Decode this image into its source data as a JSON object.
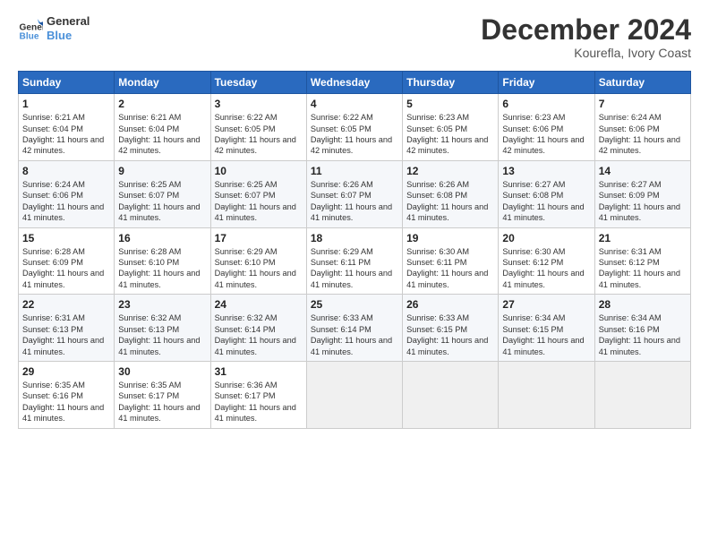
{
  "header": {
    "logo": {
      "line1": "General",
      "line2": "Blue"
    },
    "title": "December 2024",
    "subtitle": "Kourefla, Ivory Coast"
  },
  "days_of_week": [
    "Sunday",
    "Monday",
    "Tuesday",
    "Wednesday",
    "Thursday",
    "Friday",
    "Saturday"
  ],
  "weeks": [
    [
      {
        "day": 1,
        "sunrise": "6:21 AM",
        "sunset": "6:04 PM",
        "daylight": "11 hours and 42 minutes."
      },
      {
        "day": 2,
        "sunrise": "6:21 AM",
        "sunset": "6:04 PM",
        "daylight": "11 hours and 42 minutes."
      },
      {
        "day": 3,
        "sunrise": "6:22 AM",
        "sunset": "6:05 PM",
        "daylight": "11 hours and 42 minutes."
      },
      {
        "day": 4,
        "sunrise": "6:22 AM",
        "sunset": "6:05 PM",
        "daylight": "11 hours and 42 minutes."
      },
      {
        "day": 5,
        "sunrise": "6:23 AM",
        "sunset": "6:05 PM",
        "daylight": "11 hours and 42 minutes."
      },
      {
        "day": 6,
        "sunrise": "6:23 AM",
        "sunset": "6:06 PM",
        "daylight": "11 hours and 42 minutes."
      },
      {
        "day": 7,
        "sunrise": "6:24 AM",
        "sunset": "6:06 PM",
        "daylight": "11 hours and 42 minutes."
      }
    ],
    [
      {
        "day": 8,
        "sunrise": "6:24 AM",
        "sunset": "6:06 PM",
        "daylight": "11 hours and 41 minutes."
      },
      {
        "day": 9,
        "sunrise": "6:25 AM",
        "sunset": "6:07 PM",
        "daylight": "11 hours and 41 minutes."
      },
      {
        "day": 10,
        "sunrise": "6:25 AM",
        "sunset": "6:07 PM",
        "daylight": "11 hours and 41 minutes."
      },
      {
        "day": 11,
        "sunrise": "6:26 AM",
        "sunset": "6:07 PM",
        "daylight": "11 hours and 41 minutes."
      },
      {
        "day": 12,
        "sunrise": "6:26 AM",
        "sunset": "6:08 PM",
        "daylight": "11 hours and 41 minutes."
      },
      {
        "day": 13,
        "sunrise": "6:27 AM",
        "sunset": "6:08 PM",
        "daylight": "11 hours and 41 minutes."
      },
      {
        "day": 14,
        "sunrise": "6:27 AM",
        "sunset": "6:09 PM",
        "daylight": "11 hours and 41 minutes."
      }
    ],
    [
      {
        "day": 15,
        "sunrise": "6:28 AM",
        "sunset": "6:09 PM",
        "daylight": "11 hours and 41 minutes."
      },
      {
        "day": 16,
        "sunrise": "6:28 AM",
        "sunset": "6:10 PM",
        "daylight": "11 hours and 41 minutes."
      },
      {
        "day": 17,
        "sunrise": "6:29 AM",
        "sunset": "6:10 PM",
        "daylight": "11 hours and 41 minutes."
      },
      {
        "day": 18,
        "sunrise": "6:29 AM",
        "sunset": "6:11 PM",
        "daylight": "11 hours and 41 minutes."
      },
      {
        "day": 19,
        "sunrise": "6:30 AM",
        "sunset": "6:11 PM",
        "daylight": "11 hours and 41 minutes."
      },
      {
        "day": 20,
        "sunrise": "6:30 AM",
        "sunset": "6:12 PM",
        "daylight": "11 hours and 41 minutes."
      },
      {
        "day": 21,
        "sunrise": "6:31 AM",
        "sunset": "6:12 PM",
        "daylight": "11 hours and 41 minutes."
      }
    ],
    [
      {
        "day": 22,
        "sunrise": "6:31 AM",
        "sunset": "6:13 PM",
        "daylight": "11 hours and 41 minutes."
      },
      {
        "day": 23,
        "sunrise": "6:32 AM",
        "sunset": "6:13 PM",
        "daylight": "11 hours and 41 minutes."
      },
      {
        "day": 24,
        "sunrise": "6:32 AM",
        "sunset": "6:14 PM",
        "daylight": "11 hours and 41 minutes."
      },
      {
        "day": 25,
        "sunrise": "6:33 AM",
        "sunset": "6:14 PM",
        "daylight": "11 hours and 41 minutes."
      },
      {
        "day": 26,
        "sunrise": "6:33 AM",
        "sunset": "6:15 PM",
        "daylight": "11 hours and 41 minutes."
      },
      {
        "day": 27,
        "sunrise": "6:34 AM",
        "sunset": "6:15 PM",
        "daylight": "11 hours and 41 minutes."
      },
      {
        "day": 28,
        "sunrise": "6:34 AM",
        "sunset": "6:16 PM",
        "daylight": "11 hours and 41 minutes."
      }
    ],
    [
      {
        "day": 29,
        "sunrise": "6:35 AM",
        "sunset": "6:16 PM",
        "daylight": "11 hours and 41 minutes."
      },
      {
        "day": 30,
        "sunrise": "6:35 AM",
        "sunset": "6:17 PM",
        "daylight": "11 hours and 41 minutes."
      },
      {
        "day": 31,
        "sunrise": "6:36 AM",
        "sunset": "6:17 PM",
        "daylight": "11 hours and 41 minutes."
      },
      null,
      null,
      null,
      null
    ]
  ]
}
